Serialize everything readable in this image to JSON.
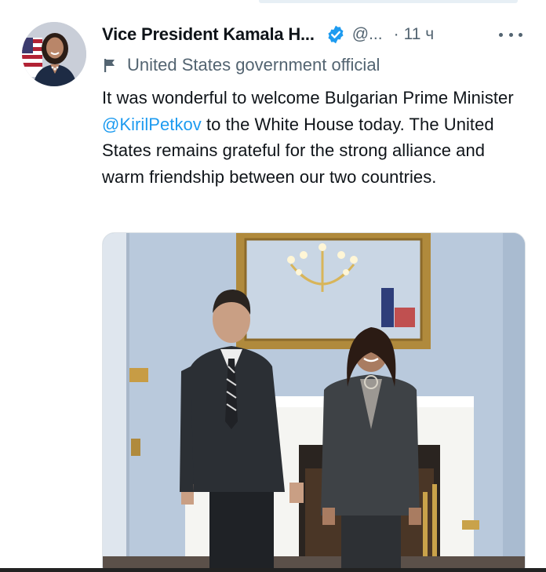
{
  "tweet": {
    "display_name": "Vice President Kamala H...",
    "handle": "@...",
    "separator": "·",
    "time": "11 ч",
    "government_label": "United States government official",
    "text_before_mention": "It was wonderful to welcome Bulgarian Prime Minister ",
    "mention": "@KirilPetkov",
    "text_after_mention": " to the White House today. The United States remains grateful for the strong alliance and warm friendship between our two countries.",
    "icons": {
      "verified": "verified-badge-icon",
      "government": "government-flag-icon",
      "more": "more-options-icon"
    }
  },
  "colors": {
    "text_primary": "#0f1419",
    "text_secondary": "#536471",
    "link": "#1d9bf0",
    "verified": "#1d9bf0"
  }
}
